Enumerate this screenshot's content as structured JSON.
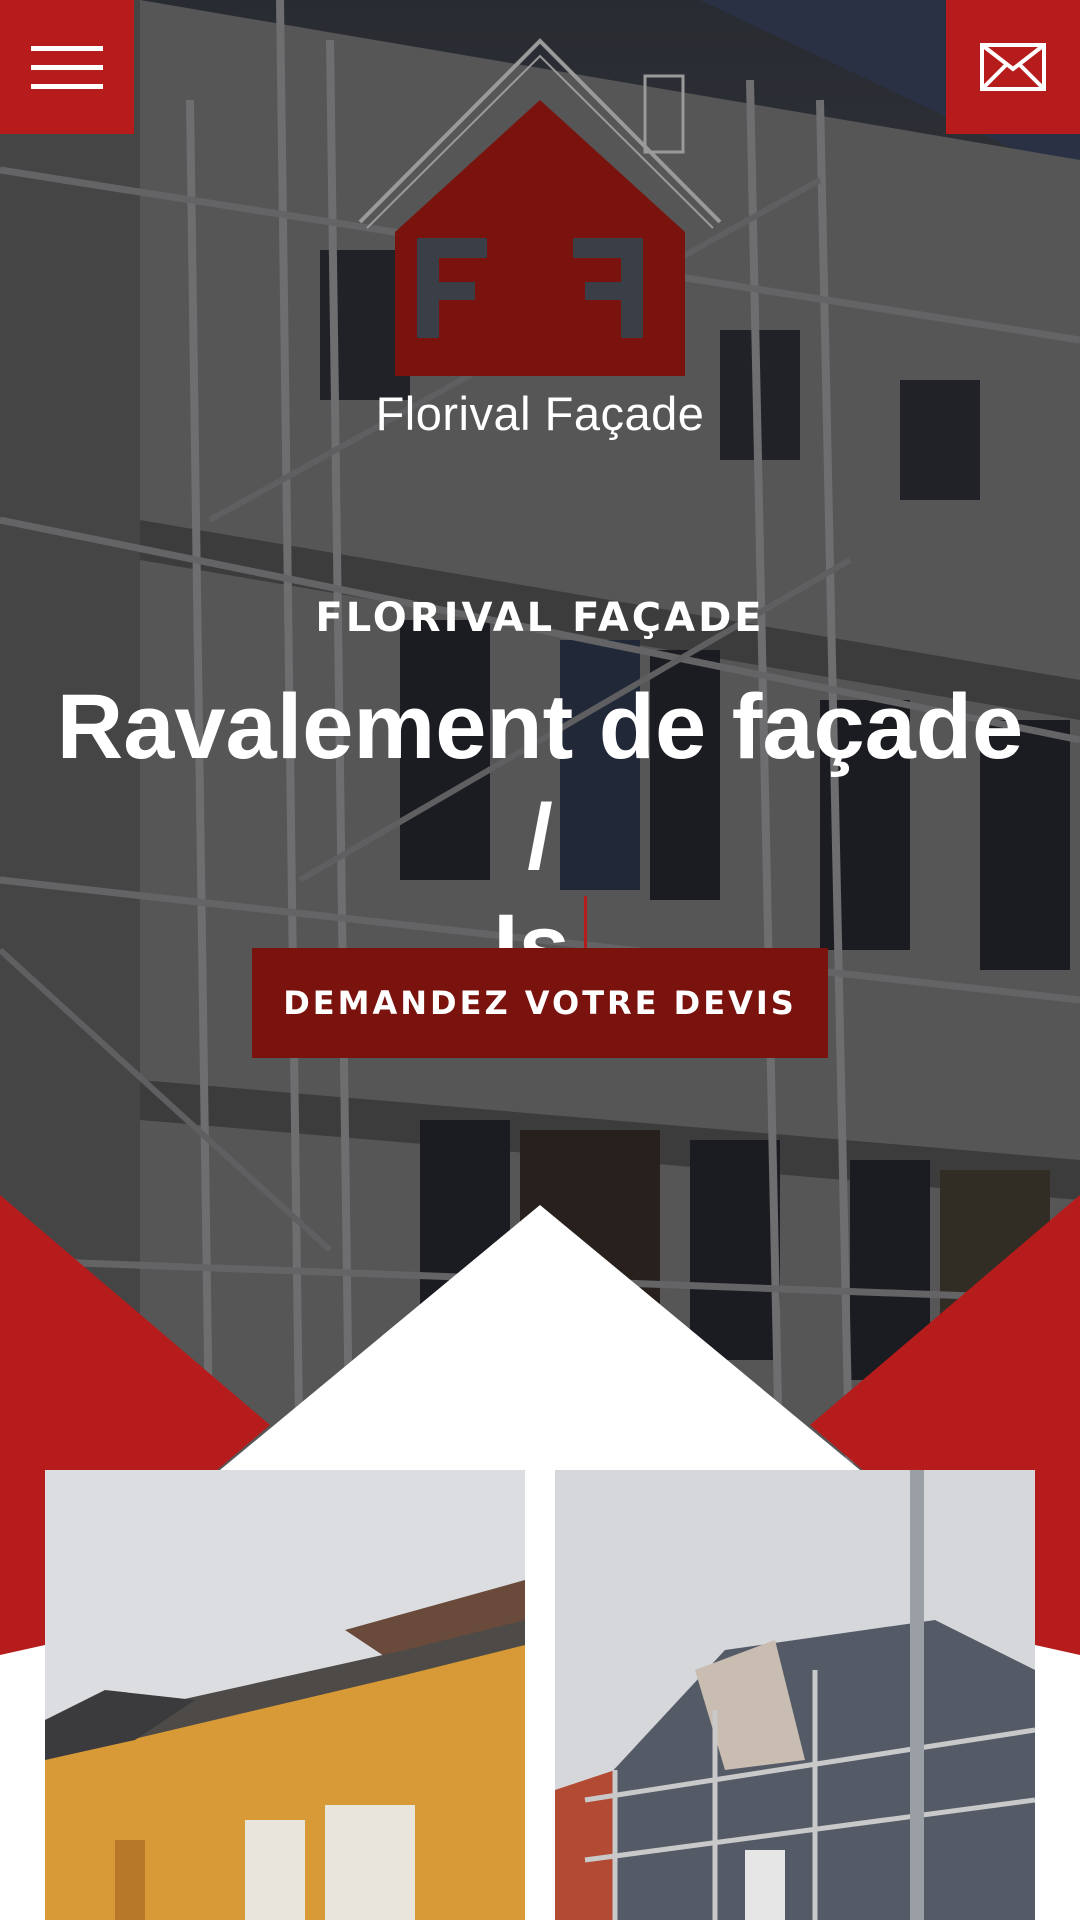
{
  "header": {
    "menu_icon": "hamburger-menu-icon",
    "mail_icon": "envelope-icon",
    "brand_color": "#b71c1c"
  },
  "logo": {
    "text": "Florival Façade",
    "icon": "house-ff-logo",
    "color": "#7a130d"
  },
  "hero": {
    "eyebrow": "FLORIVAL FAÇADE",
    "headline_line1": "Ravalement de façade /",
    "headline_line2": "Is",
    "cta_label": "DEMANDEZ VOTRE DEVIS",
    "cta_color": "#7a130d"
  },
  "gallery": {
    "items": [
      {
        "name": "yellow-house-photo"
      },
      {
        "name": "scaffolded-grey-house-photo"
      }
    ]
  }
}
